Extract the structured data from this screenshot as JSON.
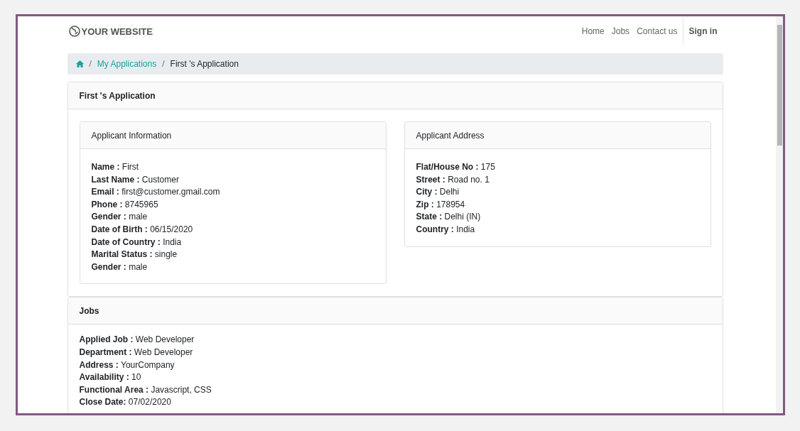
{
  "header": {
    "logo": "YOUR WEBSITE",
    "nav": [
      {
        "label": "Home",
        "kind": "link"
      },
      {
        "label": "Jobs",
        "kind": "link"
      },
      {
        "label": "Contact us",
        "kind": "link"
      },
      {
        "label": "Sign in",
        "kind": "strong"
      }
    ]
  },
  "breadcrumb": [
    {
      "separator": "/",
      "label": "My Applications",
      "kind": "link"
    },
    {
      "separator": "/",
      "label": "First 's Application",
      "kind": "current"
    }
  ],
  "application": {
    "title": "First 's Application",
    "panels": [
      {
        "title": "Applicant Information",
        "lines": [
          "**Name :** First",
          "**Last Name :** Customer",
          "**Email :** first@customer.gmail.com",
          "**Phone :** 8745965",
          "**Gender :** male",
          "**Date of Birth :** 06/15/2020",
          "**Date of Country :** India",
          "**Marital Status :** single",
          "**Gender :** male"
        ]
      },
      {
        "title": "Applicant Address",
        "lines": [
          "**Flat/House No :** 175",
          "**Street :** Road no. 1",
          "**City :** Delhi",
          "**Zip :** 178954",
          "**State :** Delhi (IN)",
          "**Country :** India"
        ]
      }
    ]
  },
  "jobs": {
    "title": "Jobs",
    "lines": [
      "**Applied Job :** Web Developer",
      "**Department :** Web Developer",
      "**Address :** YourCompany",
      "**Availability :** 10",
      "**Functional Area :** Javascript, CSS",
      "**Close Date:** 07/02/2020"
    ]
  }
}
